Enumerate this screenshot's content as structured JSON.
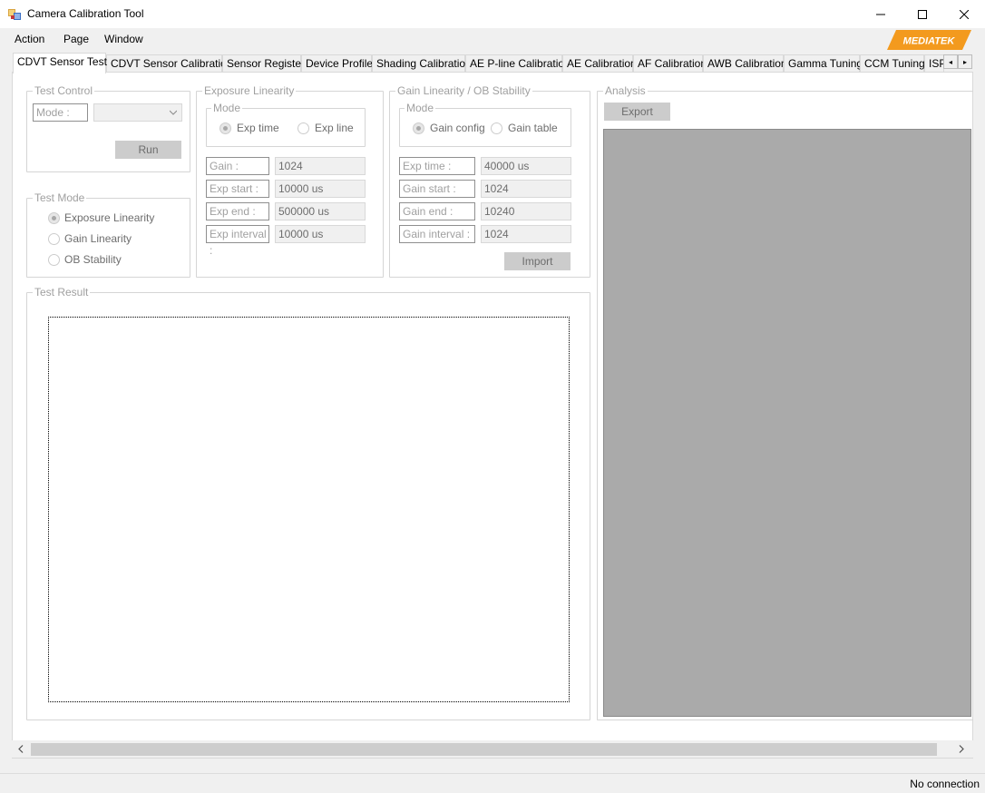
{
  "window": {
    "title": "Camera Calibration Tool",
    "minimize_icon": "minimize-icon",
    "maximize_icon": "maximize-icon",
    "close_icon": "close-icon"
  },
  "menu": {
    "items": [
      "Action",
      "Page",
      "Window"
    ]
  },
  "logo": {
    "text": "MEDIATEK",
    "color": "#f39a1e"
  },
  "tabs": {
    "items": [
      "CDVT Sensor Test",
      "CDVT Sensor Calibration",
      "Sensor Register",
      "Device Profile",
      "Shading Calibration",
      "AE P-line Calibration",
      "AE Calibration",
      "AF Calibration",
      "AWB Calibration",
      "Gamma Tuning",
      "CCM Tuning",
      "ISP"
    ],
    "active_index": 0,
    "scroll_left": "◂",
    "scroll_right": "▸"
  },
  "test_control": {
    "legend": "Test Control",
    "mode_label": "Mode :",
    "mode_value": "",
    "run": "Run"
  },
  "test_mode": {
    "legend": "Test Mode",
    "options": [
      "Exposure Linearity",
      "Gain Linearity",
      "OB Stability"
    ],
    "selected": 0
  },
  "exposure_linearity": {
    "legend": "Exposure Linearity",
    "mode_legend": "Mode",
    "mode_options": [
      "Exp time",
      "Exp line"
    ],
    "mode_selected": 0,
    "fields": [
      {
        "label": "Gain :",
        "value": "1024"
      },
      {
        "label": "Exp start :",
        "value": "10000 us"
      },
      {
        "label": "Exp end :",
        "value": "500000 us"
      },
      {
        "label": "Exp interval :",
        "value": "10000 us"
      }
    ]
  },
  "gain_linearity": {
    "legend": "Gain Linearity / OB Stability",
    "mode_legend": "Mode",
    "mode_options": [
      "Gain config",
      "Gain table"
    ],
    "mode_selected": 0,
    "fields": [
      {
        "label": "Exp time :",
        "value": "40000 us"
      },
      {
        "label": "Gain start :",
        "value": "1024"
      },
      {
        "label": "Gain end :",
        "value": "10240"
      },
      {
        "label": "Gain interval :",
        "value": "1024"
      }
    ],
    "import": "Import"
  },
  "test_result": {
    "legend": "Test Result"
  },
  "analysis": {
    "legend": "Analysis",
    "export": "Export"
  },
  "status": {
    "text": "No connection"
  }
}
